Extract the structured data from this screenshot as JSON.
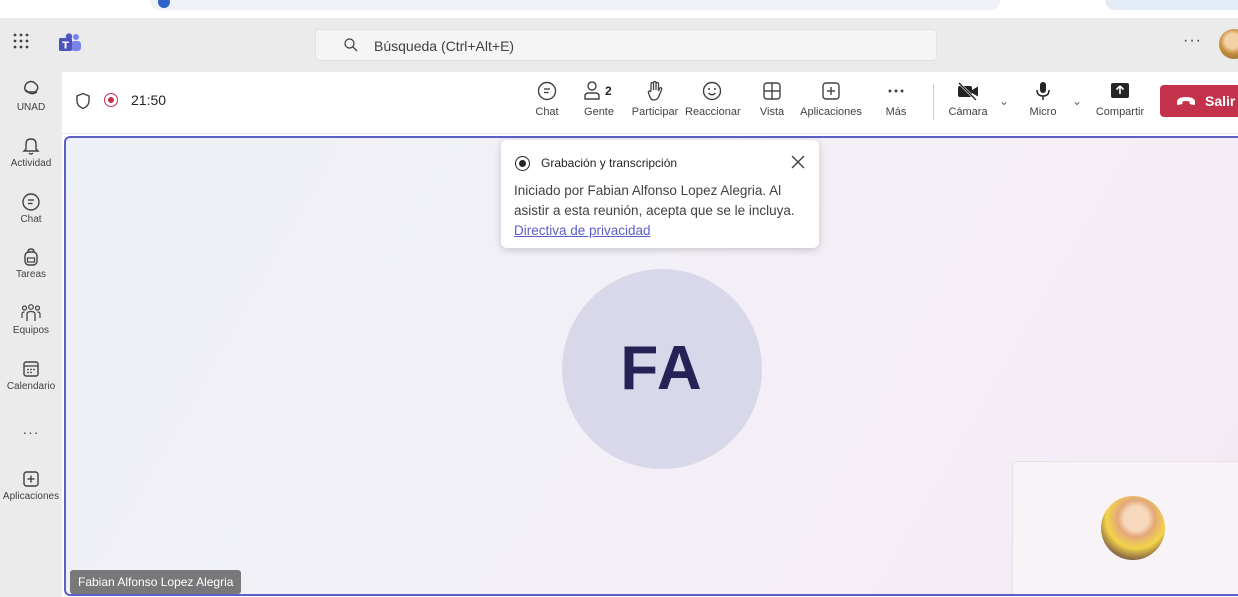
{
  "app": {
    "search_placeholder": "Búsqueda (Ctrl+Alt+E)",
    "more_glyph": "···"
  },
  "rail": {
    "items": [
      {
        "label": "UNAD",
        "icon": "org-icon"
      },
      {
        "label": "Actividad",
        "icon": "bell-icon"
      },
      {
        "label": "Chat",
        "icon": "chat-icon"
      },
      {
        "label": "Tareas",
        "icon": "backpack-icon"
      },
      {
        "label": "Equipos",
        "icon": "teams-icon"
      },
      {
        "label": "Calendario",
        "icon": "calendar-icon"
      },
      {
        "label": "···",
        "icon": "more-icon"
      },
      {
        "label": "Aplicaciones",
        "icon": "apps-icon"
      }
    ]
  },
  "meeting": {
    "timer": "21:50",
    "toolbar": {
      "chat": "Chat",
      "people": "Gente",
      "people_count": "2",
      "raise": "Participar",
      "react": "Reaccionar",
      "view": "Vista",
      "apps": "Aplicaciones",
      "more": "Más",
      "camera": "Cámara",
      "mic": "Micro",
      "share": "Compartir",
      "leave": "Salir"
    },
    "colors": {
      "leave": "#c4314b",
      "accent": "#5b5fc7",
      "recording": "#c4314b"
    }
  },
  "stage": {
    "main_initials": "FA",
    "main_name": "Fabian Alfonso Lopez Alegria"
  },
  "toast": {
    "title": "Grabación y transcripción",
    "body": "Iniciado por Fabian Alfonso Lopez Alegria. Al asistir a esta reunión, acepta que se le incluya.",
    "link": "Directiva de privacidad"
  }
}
